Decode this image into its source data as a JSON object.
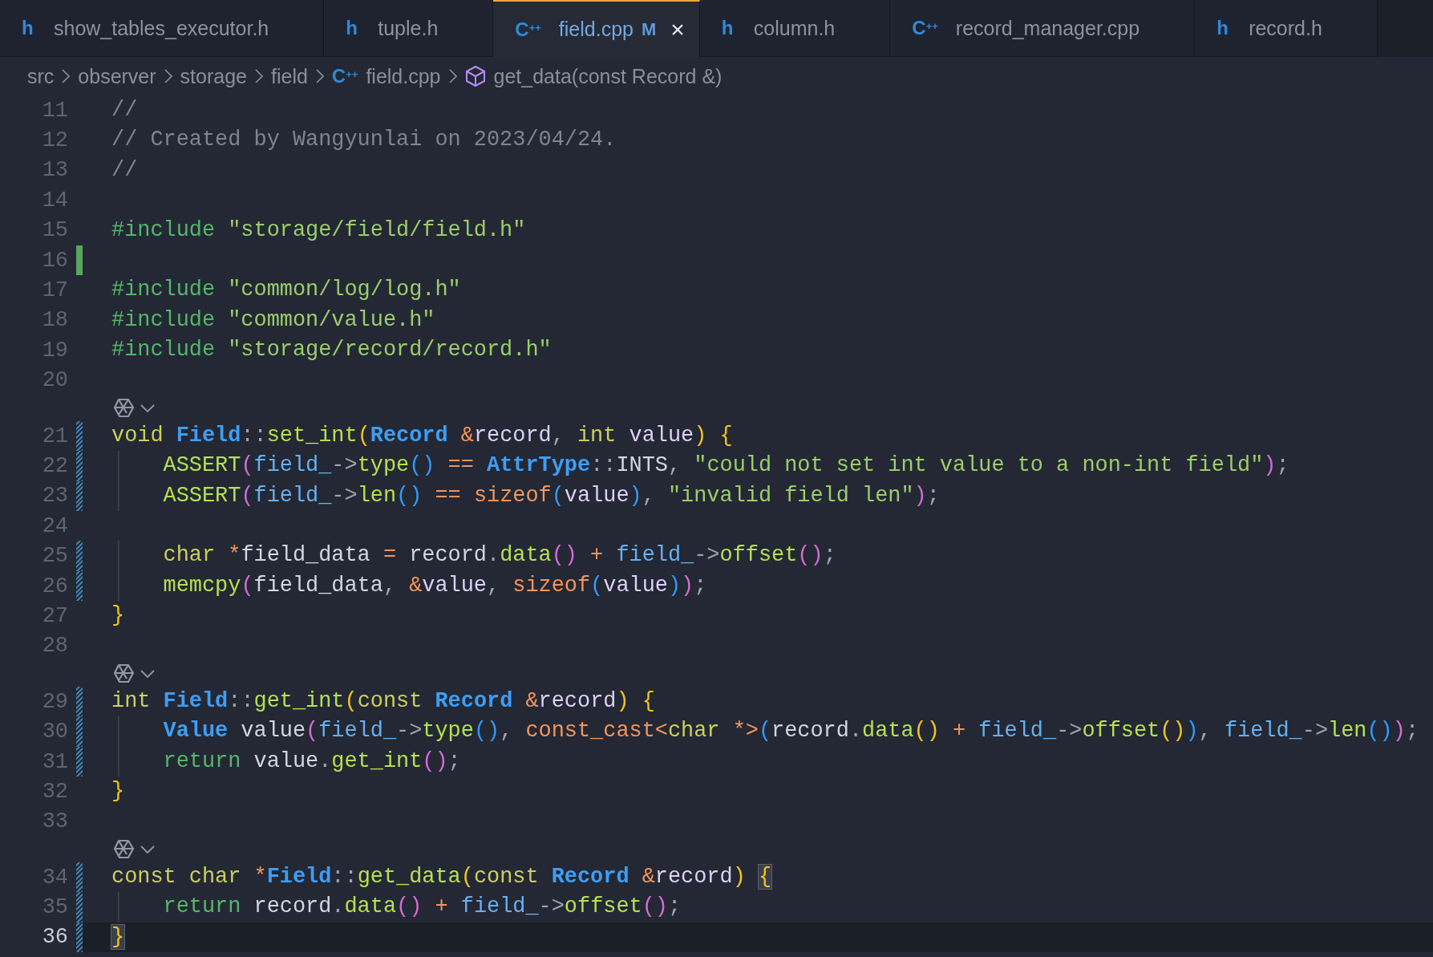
{
  "tabs": [
    {
      "icon": "h",
      "label": "show_tables_executor.h",
      "selected": false
    },
    {
      "icon": "h",
      "label": "tuple.h",
      "selected": false
    },
    {
      "icon": "C$^{++}$",
      "label": "field.cpp",
      "badge": "M",
      "close": "×",
      "selected": true
    },
    {
      "icon": "h",
      "label": "column.h",
      "selected": false
    },
    {
      "icon": "C$^{++}$",
      "label": "record_manager.cpp",
      "selected": false
    },
    {
      "icon": "h",
      "label": "record.h",
      "selected": false
    }
  ],
  "breadcrumbs": [
    {
      "kind": "folder",
      "label": "src"
    },
    {
      "kind": "folder",
      "label": "observer"
    },
    {
      "kind": "folder",
      "label": "storage"
    },
    {
      "kind": "folder",
      "label": "field"
    },
    {
      "kind": "file",
      "icon": "C$^{++}$",
      "label": "field.cpp"
    },
    {
      "kind": "symbol",
      "label": "get_data(const Record &)"
    }
  ],
  "lines": [
    {
      "kind": "code",
      "number": "11",
      "added": false,
      "modified": false,
      "current": false,
      "tokens": [
        {
          "text": "//",
          "kind": "comment"
        }
      ]
    },
    {
      "kind": "code",
      "number": "12",
      "added": false,
      "modified": false,
      "current": false,
      "tokens": [
        {
          "text": "// Created by Wangyunlai on 2023/04/24.",
          "kind": "comment"
        }
      ]
    },
    {
      "kind": "code",
      "number": "13",
      "added": false,
      "modified": false,
      "current": false,
      "tokens": [
        {
          "text": "//",
          "kind": "comment"
        }
      ]
    },
    {
      "kind": "code",
      "number": "14",
      "added": false,
      "modified": false,
      "current": false
    },
    {
      "kind": "code",
      "number": "15",
      "added": false,
      "modified": false,
      "current": false,
      "tokens": [
        {
          "text": "#include ",
          "kind": "preproc"
        },
        {
          "text": "\"storage/field/field.h\"",
          "kind": "string"
        }
      ]
    },
    {
      "kind": "code",
      "number": "16",
      "added": true,
      "modified": false,
      "current": false
    },
    {
      "kind": "code",
      "number": "17",
      "added": false,
      "modified": false,
      "current": false,
      "tokens": [
        {
          "text": "#include ",
          "kind": "preproc"
        },
        {
          "text": "\"common/log/log.h\"",
          "kind": "string"
        }
      ]
    },
    {
      "kind": "code",
      "number": "18",
      "added": false,
      "modified": false,
      "current": false,
      "tokens": [
        {
          "text": "#include ",
          "kind": "preproc"
        },
        {
          "text": "\"common/value.h\"",
          "kind": "string"
        }
      ]
    },
    {
      "kind": "code",
      "number": "19",
      "added": false,
      "modified": false,
      "current": false,
      "tokens": [
        {
          "text": "#include ",
          "kind": "preproc"
        },
        {
          "text": "\"storage/record/record.h\"",
          "kind": "string"
        }
      ]
    },
    {
      "kind": "code",
      "number": "20",
      "added": false,
      "modified": false,
      "current": false
    },
    {
      "kind": "lens"
    },
    {
      "kind": "code",
      "number": "21",
      "added": false,
      "modified": true,
      "current": false,
      "tokens": [
        {
          "text": "void ",
          "kind": "keyword"
        },
        {
          "text": "Field",
          "kind": "type"
        },
        {
          "text": "::",
          "kind": "op"
        },
        {
          "text": "set_int",
          "kind": "func"
        },
        {
          "text": "(",
          "kind": "p1"
        },
        {
          "text": "Record ",
          "kind": "type"
        },
        {
          "text": "&",
          "kind": "amp"
        },
        {
          "text": "record",
          "kind": "param"
        },
        {
          "text": ", ",
          "kind": "punc"
        },
        {
          "text": "int ",
          "kind": "keyword"
        },
        {
          "text": "value",
          "kind": "param"
        },
        {
          "text": ") ",
          "kind": "p1"
        },
        {
          "text": "{",
          "kind": "p1"
        }
      ]
    },
    {
      "kind": "code",
      "number": "22",
      "added": false,
      "modified": true,
      "current": false,
      "tokens": [
        {
          "text": "    ASSERT",
          "kind": "func"
        },
        {
          "text": "(",
          "kind": "p2"
        },
        {
          "text": "field_",
          "kind": "member"
        },
        {
          "text": "->",
          "kind": "op"
        },
        {
          "text": "type",
          "kind": "func"
        },
        {
          "text": "()",
          "kind": "p3"
        },
        {
          "text": " == ",
          "kind": "amp"
        },
        {
          "text": "AttrType",
          "kind": "type"
        },
        {
          "text": "::",
          "kind": "op"
        },
        {
          "text": "INTS",
          "kind": "plain"
        },
        {
          "text": ", ",
          "kind": "punc"
        },
        {
          "text": "\"could not set int value to a non-int field\"",
          "kind": "string"
        },
        {
          "text": ")",
          "kind": "p2"
        },
        {
          "text": ";",
          "kind": "punc"
        }
      ]
    },
    {
      "kind": "code",
      "number": "23",
      "added": false,
      "modified": true,
      "current": false,
      "tokens": [
        {
          "text": "    ASSERT",
          "kind": "func"
        },
        {
          "text": "(",
          "kind": "p2"
        },
        {
          "text": "field_",
          "kind": "member"
        },
        {
          "text": "->",
          "kind": "op"
        },
        {
          "text": "len",
          "kind": "func"
        },
        {
          "text": "()",
          "kind": "p3"
        },
        {
          "text": " == sizeof",
          "kind": "amp"
        },
        {
          "text": "(",
          "kind": "p3"
        },
        {
          "text": "value",
          "kind": "param"
        },
        {
          "text": ")",
          "kind": "p3"
        },
        {
          "text": ", ",
          "kind": "punc"
        },
        {
          "text": "\"invalid field len\"",
          "kind": "string"
        },
        {
          "text": ")",
          "kind": "p2"
        },
        {
          "text": ";",
          "kind": "punc"
        }
      ]
    },
    {
      "kind": "code",
      "number": "24",
      "added": false,
      "modified": false,
      "current": false
    },
    {
      "kind": "code",
      "number": "25",
      "added": false,
      "modified": true,
      "current": false,
      "tokens": [
        {
          "text": "    char ",
          "kind": "keyword"
        },
        {
          "text": "*",
          "kind": "amp"
        },
        {
          "text": "field_data ",
          "kind": "plain"
        },
        {
          "text": "= ",
          "kind": "amp"
        },
        {
          "text": "record",
          "kind": "plain"
        },
        {
          "text": ".",
          "kind": "punc"
        },
        {
          "text": "data",
          "kind": "func"
        },
        {
          "text": "()",
          "kind": "p2"
        },
        {
          "text": " + ",
          "kind": "amp"
        },
        {
          "text": "field_",
          "kind": "member"
        },
        {
          "text": "->",
          "kind": "op"
        },
        {
          "text": "offset",
          "kind": "func"
        },
        {
          "text": "()",
          "kind": "p2"
        },
        {
          "text": ";",
          "kind": "punc"
        }
      ]
    },
    {
      "kind": "code",
      "number": "26",
      "added": false,
      "modified": true,
      "current": false,
      "tokens": [
        {
          "text": "    memcpy",
          "kind": "func"
        },
        {
          "text": "(",
          "kind": "p2"
        },
        {
          "text": "field_data",
          "kind": "plain"
        },
        {
          "text": ", ",
          "kind": "punc"
        },
        {
          "text": "&",
          "kind": "amp"
        },
        {
          "text": "value",
          "kind": "param"
        },
        {
          "text": ", ",
          "kind": "punc"
        },
        {
          "text": "sizeof",
          "kind": "amp"
        },
        {
          "text": "(",
          "kind": "p3"
        },
        {
          "text": "value",
          "kind": "param"
        },
        {
          "text": ")",
          "kind": "p3"
        },
        {
          "text": ")",
          "kind": "p2"
        },
        {
          "text": ";",
          "kind": "punc"
        }
      ]
    },
    {
      "kind": "code",
      "number": "27",
      "added": false,
      "modified": false,
      "current": false,
      "tokens": [
        {
          "text": "}",
          "kind": "p1"
        }
      ]
    },
    {
      "kind": "code",
      "number": "28",
      "added": false,
      "modified": false,
      "current": false
    },
    {
      "kind": "lens"
    },
    {
      "kind": "code",
      "number": "29",
      "added": false,
      "modified": true,
      "current": false,
      "tokens": [
        {
          "text": "int ",
          "kind": "keyword"
        },
        {
          "text": "Field",
          "kind": "type"
        },
        {
          "text": "::",
          "kind": "op"
        },
        {
          "text": "get_int",
          "kind": "func"
        },
        {
          "text": "(",
          "kind": "p1"
        },
        {
          "text": "const ",
          "kind": "keyword"
        },
        {
          "text": "Record ",
          "kind": "type"
        },
        {
          "text": "&",
          "kind": "amp"
        },
        {
          "text": "record",
          "kind": "param"
        },
        {
          "text": ") ",
          "kind": "p1"
        },
        {
          "text": "{",
          "kind": "p1"
        }
      ]
    },
    {
      "kind": "code",
      "number": "30",
      "added": false,
      "modified": true,
      "current": false,
      "tokens": [
        {
          "text": "    Value",
          "kind": "type"
        },
        {
          "text": " value",
          "kind": "plain"
        },
        {
          "text": "(",
          "kind": "p2"
        },
        {
          "text": "field_",
          "kind": "member"
        },
        {
          "text": "->",
          "kind": "op"
        },
        {
          "text": "type",
          "kind": "func"
        },
        {
          "text": "()",
          "kind": "p3"
        },
        {
          "text": ", ",
          "kind": "punc"
        },
        {
          "text": "const_cast<",
          "kind": "amp"
        },
        {
          "text": "char ",
          "kind": "keyword"
        },
        {
          "text": "*>",
          "kind": "amp"
        },
        {
          "text": "(",
          "kind": "p3"
        },
        {
          "text": "record",
          "kind": "plain"
        },
        {
          "text": ".",
          "kind": "punc"
        },
        {
          "text": "data",
          "kind": "func"
        },
        {
          "text": "()",
          "kind": "p1"
        },
        {
          "text": " + ",
          "kind": "amp"
        },
        {
          "text": "field_",
          "kind": "member"
        },
        {
          "text": "->",
          "kind": "op"
        },
        {
          "text": "offset",
          "kind": "func"
        },
        {
          "text": "()",
          "kind": "p1"
        },
        {
          "text": ")",
          "kind": "p3"
        },
        {
          "text": ", ",
          "kind": "punc"
        },
        {
          "text": "field_",
          "kind": "member"
        },
        {
          "text": "->",
          "kind": "op"
        },
        {
          "text": "len",
          "kind": "func"
        },
        {
          "text": "()",
          "kind": "p3"
        },
        {
          "text": ")",
          "kind": "p2"
        },
        {
          "text": ";",
          "kind": "punc"
        }
      ]
    },
    {
      "kind": "code",
      "number": "31",
      "added": false,
      "modified": true,
      "current": false,
      "tokens": [
        {
          "text": "    return ",
          "kind": "return"
        },
        {
          "text": "value",
          "kind": "plain"
        },
        {
          "text": ".",
          "kind": "punc"
        },
        {
          "text": "get_int",
          "kind": "func"
        },
        {
          "text": "()",
          "kind": "p2"
        },
        {
          "text": ";",
          "kind": "punc"
        }
      ]
    },
    {
      "kind": "code",
      "number": "32",
      "added": false,
      "modified": false,
      "current": false,
      "tokens": [
        {
          "text": "}",
          "kind": "p1"
        }
      ]
    },
    {
      "kind": "code",
      "number": "33",
      "added": false,
      "modified": false,
      "current": false
    },
    {
      "kind": "lens"
    },
    {
      "kind": "code",
      "number": "34",
      "added": false,
      "modified": true,
      "current": false,
      "tokens": [
        {
          "text": "const char ",
          "kind": "keyword"
        },
        {
          "text": "*",
          "kind": "amp"
        },
        {
          "text": "Field",
          "kind": "type"
        },
        {
          "text": "::",
          "kind": "op"
        },
        {
          "text": "get_data",
          "kind": "func"
        },
        {
          "text": "(",
          "kind": "p1"
        },
        {
          "text": "const ",
          "kind": "keyword"
        },
        {
          "text": "Record ",
          "kind": "type"
        },
        {
          "text": "&",
          "kind": "amp"
        },
        {
          "text": "record",
          "kind": "param"
        },
        {
          "text": ") ",
          "kind": "p1"
        },
        {
          "text": "{",
          "kind": "match"
        }
      ]
    },
    {
      "kind": "code",
      "number": "35",
      "added": false,
      "modified": true,
      "current": false,
      "tokens": [
        {
          "text": "    return ",
          "kind": "return"
        },
        {
          "text": "record",
          "kind": "plain"
        },
        {
          "text": ".",
          "kind": "punc"
        },
        {
          "text": "data",
          "kind": "func"
        },
        {
          "text": "()",
          "kind": "p2"
        },
        {
          "text": " + ",
          "kind": "amp"
        },
        {
          "text": "field_",
          "kind": "member"
        },
        {
          "text": "->",
          "kind": "op"
        },
        {
          "text": "offset",
          "kind": "func"
        },
        {
          "text": "()",
          "kind": "p2"
        },
        {
          "text": ";",
          "kind": "punc"
        }
      ]
    },
    {
      "kind": "code",
      "number": "36",
      "added": false,
      "modified": true,
      "current": true,
      "tokens": [
        {
          "text": "}",
          "kind": "match"
        }
      ]
    }
  ]
}
